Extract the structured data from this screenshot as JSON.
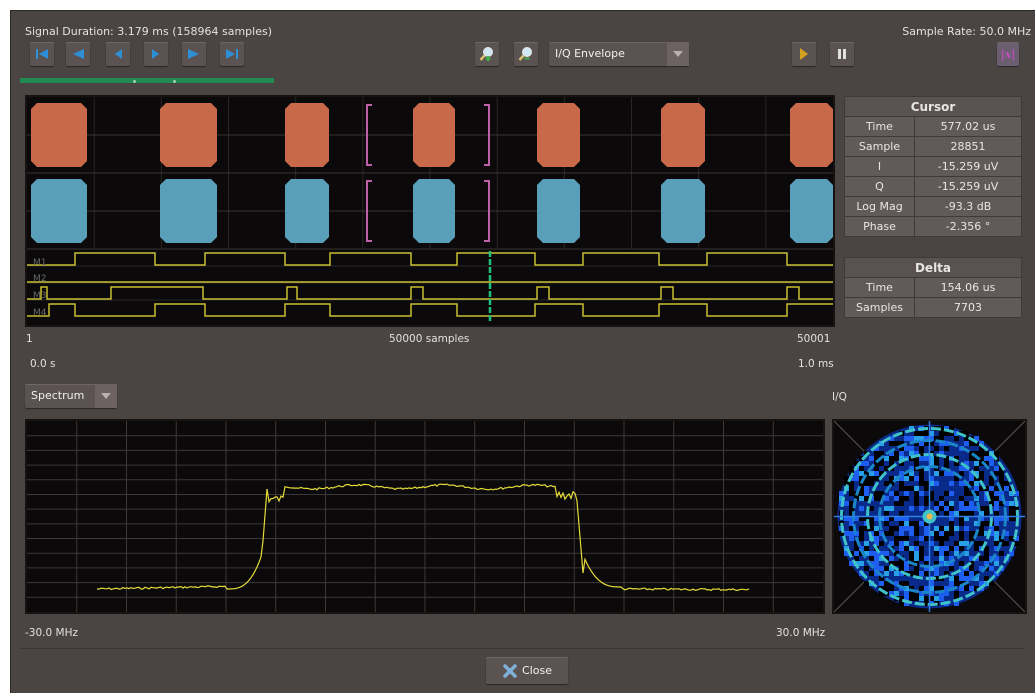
{
  "header": {
    "signal_duration": "Signal Duration:  3.179 ms (158964 samples)",
    "sample_rate": "Sample Rate: 50.0 MHz"
  },
  "toolbar": {
    "nav_buttons": [
      "skip-to-start",
      "step-back-large",
      "step-back",
      "step-forward",
      "step-forward-large",
      "skip-to-end"
    ],
    "zoom_in_icon": "zoom-in-icon",
    "zoom_out_icon": "zoom-out-icon",
    "view_mode": "I/Q Envelope",
    "play_icon": "play-icon",
    "pause_icon": "pause-icon",
    "formula_label": "|x|"
  },
  "progress": {
    "fraction": 0.31
  },
  "time_plot": {
    "channel_labels": [
      "M1",
      "M2",
      "M3",
      "M4"
    ],
    "sample_start": "1",
    "sample_center": "50000 samples",
    "sample_end": "50001",
    "time_start": "0.0  s",
    "time_end": "1.0 ms"
  },
  "cursor": {
    "title": "Cursor",
    "rows": [
      {
        "label": "Time",
        "value": "577.02 us"
      },
      {
        "label": "Sample",
        "value": "28851"
      },
      {
        "label": "I",
        "value": "-15.259 uV"
      },
      {
        "label": "Q",
        "value": "-15.259 uV"
      },
      {
        "label": "Log Mag",
        "value": "-93.3 dB"
      },
      {
        "label": "Phase",
        "value": "-2.356 °"
      }
    ]
  },
  "delta": {
    "title": "Delta",
    "rows": [
      {
        "label": "Time",
        "value": "154.06 us"
      },
      {
        "label": "Samples",
        "value": "7703"
      }
    ]
  },
  "spectrum": {
    "mode": "Spectrum",
    "freq_start": "-30.0 MHz",
    "freq_end": "30.0 MHz",
    "trace_color": "#e6dc3a"
  },
  "iq": {
    "label": "I/Q"
  },
  "colors": {
    "i_trace": "#c8694a",
    "q_trace": "#5a9fba",
    "marker": "#c8c032",
    "bracket": "#c060a8",
    "cursor_line": "#1ec080"
  },
  "footer": {
    "close_label": "Close"
  }
}
